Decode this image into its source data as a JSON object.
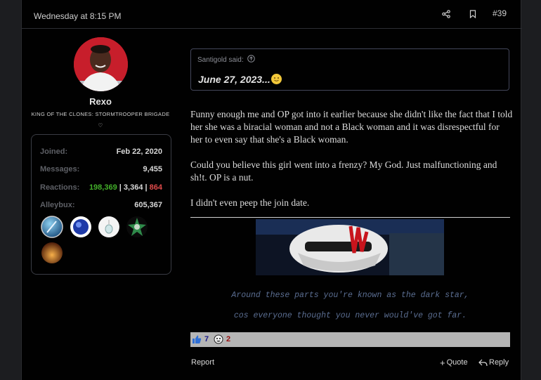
{
  "header": {
    "date": "Wednesday at 8:15 PM",
    "post_number": "#39",
    "share_icon": "share-icon",
    "bookmark_icon": "bookmark-icon"
  },
  "user": {
    "name": "Rexo",
    "title": "KING OF THE CLONES: STORMTROOPER BRIGADE ♡",
    "stats": {
      "joined_label": "Joined:",
      "joined_value": "Feb 22, 2020",
      "messages_label": "Messages:",
      "messages_value": "9,455",
      "reactions_label": "Reactions:",
      "reactions_positive": "198,369",
      "reactions_neutral": "3,364",
      "reactions_negative": "864",
      "reactions_sep": "|",
      "alleybux_label": "Alleybux:",
      "alleybux_value": "605,367"
    },
    "badge_colors": [
      "#3a8fc8",
      "#2d4fbf",
      "#e8e8e8",
      "#2e7a3e",
      "#c0501a"
    ]
  },
  "quote": {
    "attribution": "Santigold said:",
    "text": "June 27, 2023..."
  },
  "body": {
    "paragraphs": [
      "Funny enough me and OP got into it earlier because she didn't like the fact that I told her she was a biracial woman and not a Black woman and it was disrespectful for her to even say that she's a Black woman.",
      "Could you believe this girl went into a frenzy? My God. Just malfunctioning and sh!t. OP is a nut.",
      "I didn't even peep the join date."
    ]
  },
  "signature": {
    "line1": "Around these parts you're known as the dark star,",
    "line2": "cos everyone thought you never would've got far."
  },
  "reactions": {
    "like_count": "7",
    "other_count": "2"
  },
  "footer": {
    "report": "Report",
    "quote": "Quote",
    "reply": "Reply"
  },
  "colors": {
    "background": "#010101",
    "page": "#1c1d20",
    "positive": "#43b02a",
    "negative": "#e04b4b",
    "signature": "#5b6e92"
  }
}
